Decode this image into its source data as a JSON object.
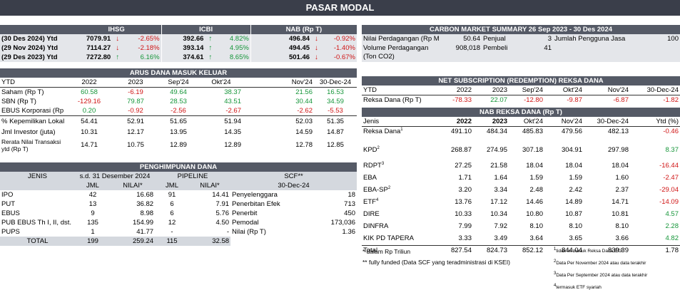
{
  "title": "PASAR MODAL",
  "indices": {
    "headers": [
      "IHSG",
      "ICBI",
      "NAB (Rp T)"
    ],
    "rows": [
      {
        "date": "(30 Des 2024) Ytd",
        "ihsg": "7079.91",
        "ihsg_chg": "-2.65%",
        "ihsg_dir": "down",
        "icbi": "392.66",
        "icbi_chg": "4.82%",
        "icbi_dir": "up",
        "nab": "496.84",
        "nab_chg": "-0.92%",
        "nab_dir": "down"
      },
      {
        "date": "(29 Nov 2024) Ytd",
        "ihsg": "7114.27",
        "ihsg_chg": "-2.18%",
        "ihsg_dir": "down",
        "icbi": "393.14",
        "icbi_chg": "4.95%",
        "icbi_dir": "up",
        "nab": "494.45",
        "nab_chg": "-1.40%",
        "nab_dir": "down"
      },
      {
        "date": "(29 Des 2023) Ytd",
        "ihsg": "7272.80",
        "ihsg_chg": "6.16%",
        "ihsg_dir": "up",
        "icbi": "374.61",
        "icbi_chg": "8.65%",
        "icbi_dir": "up",
        "nab": "501.46",
        "nab_chg": "-0.67%",
        "nab_dir": "down"
      }
    ]
  },
  "arus": {
    "header": "ARUS DANA MASUK KELUAR",
    "cols": [
      "YTD",
      "2022",
      "2023",
      "Sep'24",
      "Okt'24",
      "Nov'24",
      "30-Dec-24"
    ],
    "rows": [
      {
        "label": "Saham (Rp T)",
        "v": [
          "60.58",
          "-6.19",
          "49.64",
          "38.37",
          "21.56",
          "16.53"
        ],
        "c": [
          "g",
          "r",
          "g",
          "g",
          "g",
          "g"
        ]
      },
      {
        "label": "SBN (Rp T)",
        "v": [
          "-129.16",
          "79.87",
          "28.53",
          "43.51",
          "30.44",
          "34.59"
        ],
        "c": [
          "r",
          "g",
          "g",
          "g",
          "g",
          "g"
        ]
      },
      {
        "label": "EBUS Korporasi (Rp T)",
        "v": [
          "0.20",
          "-0.92",
          "-2.56",
          "-2.67",
          "-2.62",
          "-5.53"
        ],
        "c": [
          "g",
          "r",
          "r",
          "r",
          "r",
          "r"
        ]
      },
      {
        "label": "% Kepemilikan Lokal",
        "v": [
          "54.41",
          "52.91",
          "51.65",
          "51.94",
          "52.03",
          "51.35"
        ],
        "c": [
          "",
          "",
          "",
          "",
          "",
          ""
        ]
      },
      {
        "label": "Jml Investor (juta)",
        "v": [
          "10.31",
          "12.17",
          "13.95",
          "14.35",
          "14.59",
          "14.87"
        ],
        "c": [
          "",
          "",
          "",
          "",
          "",
          ""
        ]
      },
      {
        "label": "Rerata Nilai Transaksi ytd (Rp T)",
        "v": [
          "14.71",
          "10.75",
          "12.89",
          "12.89",
          "12.78",
          "12.85"
        ],
        "c": [
          "",
          "",
          "",
          "",
          "",
          ""
        ]
      }
    ]
  },
  "penghimpunan": {
    "header": "PENGHIMPUNAN DANA",
    "h_jenis": "JENIS",
    "h_sd": "s.d. 31 Desember 2024",
    "h_pipeline": "PIPELINE",
    "h_scf": "SCF**",
    "h_jml": "JML",
    "h_nilai": "NILAI*",
    "h_date": "30-Dec-24",
    "rows": [
      {
        "jenis": "IPO",
        "jml": "42",
        "nilai": "16.68",
        "pjml": "91",
        "pnilai": "14.41",
        "slabel": "Penyelenggara",
        "sval": "18"
      },
      {
        "jenis": "PUT",
        "jml": "13",
        "nilai": "36.82",
        "pjml": "6",
        "pnilai": "7.91",
        "slabel": "Penerbitan Efek",
        "sval": "713"
      },
      {
        "jenis": "EBUS",
        "jml": "9",
        "nilai": "8.98",
        "pjml": "6",
        "pnilai": "5.76",
        "slabel": "Penerbit",
        "sval": "450"
      },
      {
        "jenis": "PUB EBUS Th I, II, dst.",
        "jml": "135",
        "nilai": "154.99",
        "pjml": "12",
        "pnilai": "4.50",
        "slabel": "Pemodal",
        "sval": "173,036"
      },
      {
        "jenis": "PUPS",
        "jml": "1",
        "nilai": "41.77",
        "pjml": "-",
        "pnilai": "-",
        "slabel": "Nilai (Rp T)",
        "sval": "1.36"
      }
    ],
    "total": {
      "jenis": "TOTAL",
      "jml": "199",
      "nilai": "259.24",
      "pjml": "115",
      "pnilai": "32.58"
    }
  },
  "carbon": {
    "header": "CARBON MARKET SUMMARY 26 Sep 2023 - 30 Des 2024",
    "r1_label": "Nilai Perdagangan (Rp M)",
    "r1_val": "50.64",
    "r1_label2": "Penjual",
    "r1_val2": "3",
    "r1_label3": "Jumlah Pengguna Jasa",
    "r1_val3": "100",
    "r2_label": "Volume Perdagangan (Ton CO2)",
    "r2_val": "908,018",
    "r2_label2": "Pembeli",
    "r2_val2": "41"
  },
  "netsub": {
    "header": "NET SUBSCRIPTION (REDEMPTION) REKSA DANA",
    "cols": [
      "YTD",
      "2022",
      "2023",
      "Sep'24",
      "Okt'24",
      "Nov'24",
      "30-Dec-24"
    ],
    "row": {
      "label": "Reksa Dana (Rp T)",
      "v": [
        "-78.33",
        "22.07",
        "-12.80",
        "-9.87",
        "-6.87",
        "-1.82"
      ],
      "c": [
        "r",
        "g",
        "r",
        "r",
        "r",
        "r"
      ]
    }
  },
  "nab": {
    "header": "NAB REKSA DANA (Rp T)",
    "cols": [
      "Jenis",
      "2022",
      "2023",
      "Okt'24",
      "Nov'24",
      "30-Dec-24",
      "Ytd (%)"
    ],
    "rows": [
      {
        "label": "Reksa Dana",
        "sup": "1",
        "v": [
          "491.10",
          "484.34",
          "485.83",
          "479.56",
          "482.13",
          "-0.46"
        ],
        "c": "r"
      },
      {
        "label": "KPD",
        "sup": "2",
        "v": [
          "268.87",
          "274.95",
          "307.18",
          "304.91",
          "297.98",
          "8.37"
        ],
        "c": "g"
      },
      {
        "label": "RDPT",
        "sup": "3",
        "v": [
          "27.25",
          "21.58",
          "18.04",
          "18.04",
          "18.04",
          "-16.44"
        ],
        "c": "r"
      },
      {
        "label": "EBA",
        "sup": "",
        "v": [
          "1.71",
          "1.64",
          "1.59",
          "1.59",
          "1.60",
          "-2.47"
        ],
        "c": "r"
      },
      {
        "label": "EBA-SP",
        "sup": "2",
        "v": [
          "3.20",
          "3.34",
          "2.48",
          "2.42",
          "2.37",
          "-29.04"
        ],
        "c": "r"
      },
      {
        "label": "ETF",
        "sup": "4",
        "v": [
          "13.76",
          "17.12",
          "14.46",
          "14.89",
          "14.71",
          "-14.09"
        ],
        "c": "r"
      },
      {
        "label": "DIRE",
        "sup": "",
        "v": [
          "10.33",
          "10.34",
          "10.80",
          "10.87",
          "10.81",
          "4.57"
        ],
        "c": "g"
      },
      {
        "label": "DINFRA",
        "sup": "",
        "v": [
          "7.99",
          "7.92",
          "8.10",
          "8.10",
          "8.10",
          "2.28"
        ],
        "c": "g"
      },
      {
        "label": "KIK PD TAPERA",
        "sup": "",
        "v": [
          "3.33",
          "3.49",
          "3.64",
          "3.65",
          "3.66",
          "4.82"
        ],
        "c": "g"
      }
    ],
    "total": {
      "label": "Total",
      "v": [
        "827.54",
        "824.73",
        "852.12",
        "844.04",
        "839.39",
        "1.78"
      ]
    }
  },
  "notes": {
    "n1": "* dalam Rp Triliun",
    "n2": "** fully funded (Data SCF yang teradministrasi di KSEI)",
    "f1": "tidak termasuk Reksa Dana ETF",
    "f2": "Data Per November 2024 atau data terakhir",
    "f3": "Data Per September 2024 atau data terakhir",
    "f4": "termasuk ETF syariah",
    "f1n": "1",
    "f2n": "2",
    "f3n": "3",
    "f4n": "4"
  },
  "colors": {
    "red": "#d01515",
    "green": "#16963a",
    "header": "#555a66",
    "title": "#3a3e4a"
  }
}
